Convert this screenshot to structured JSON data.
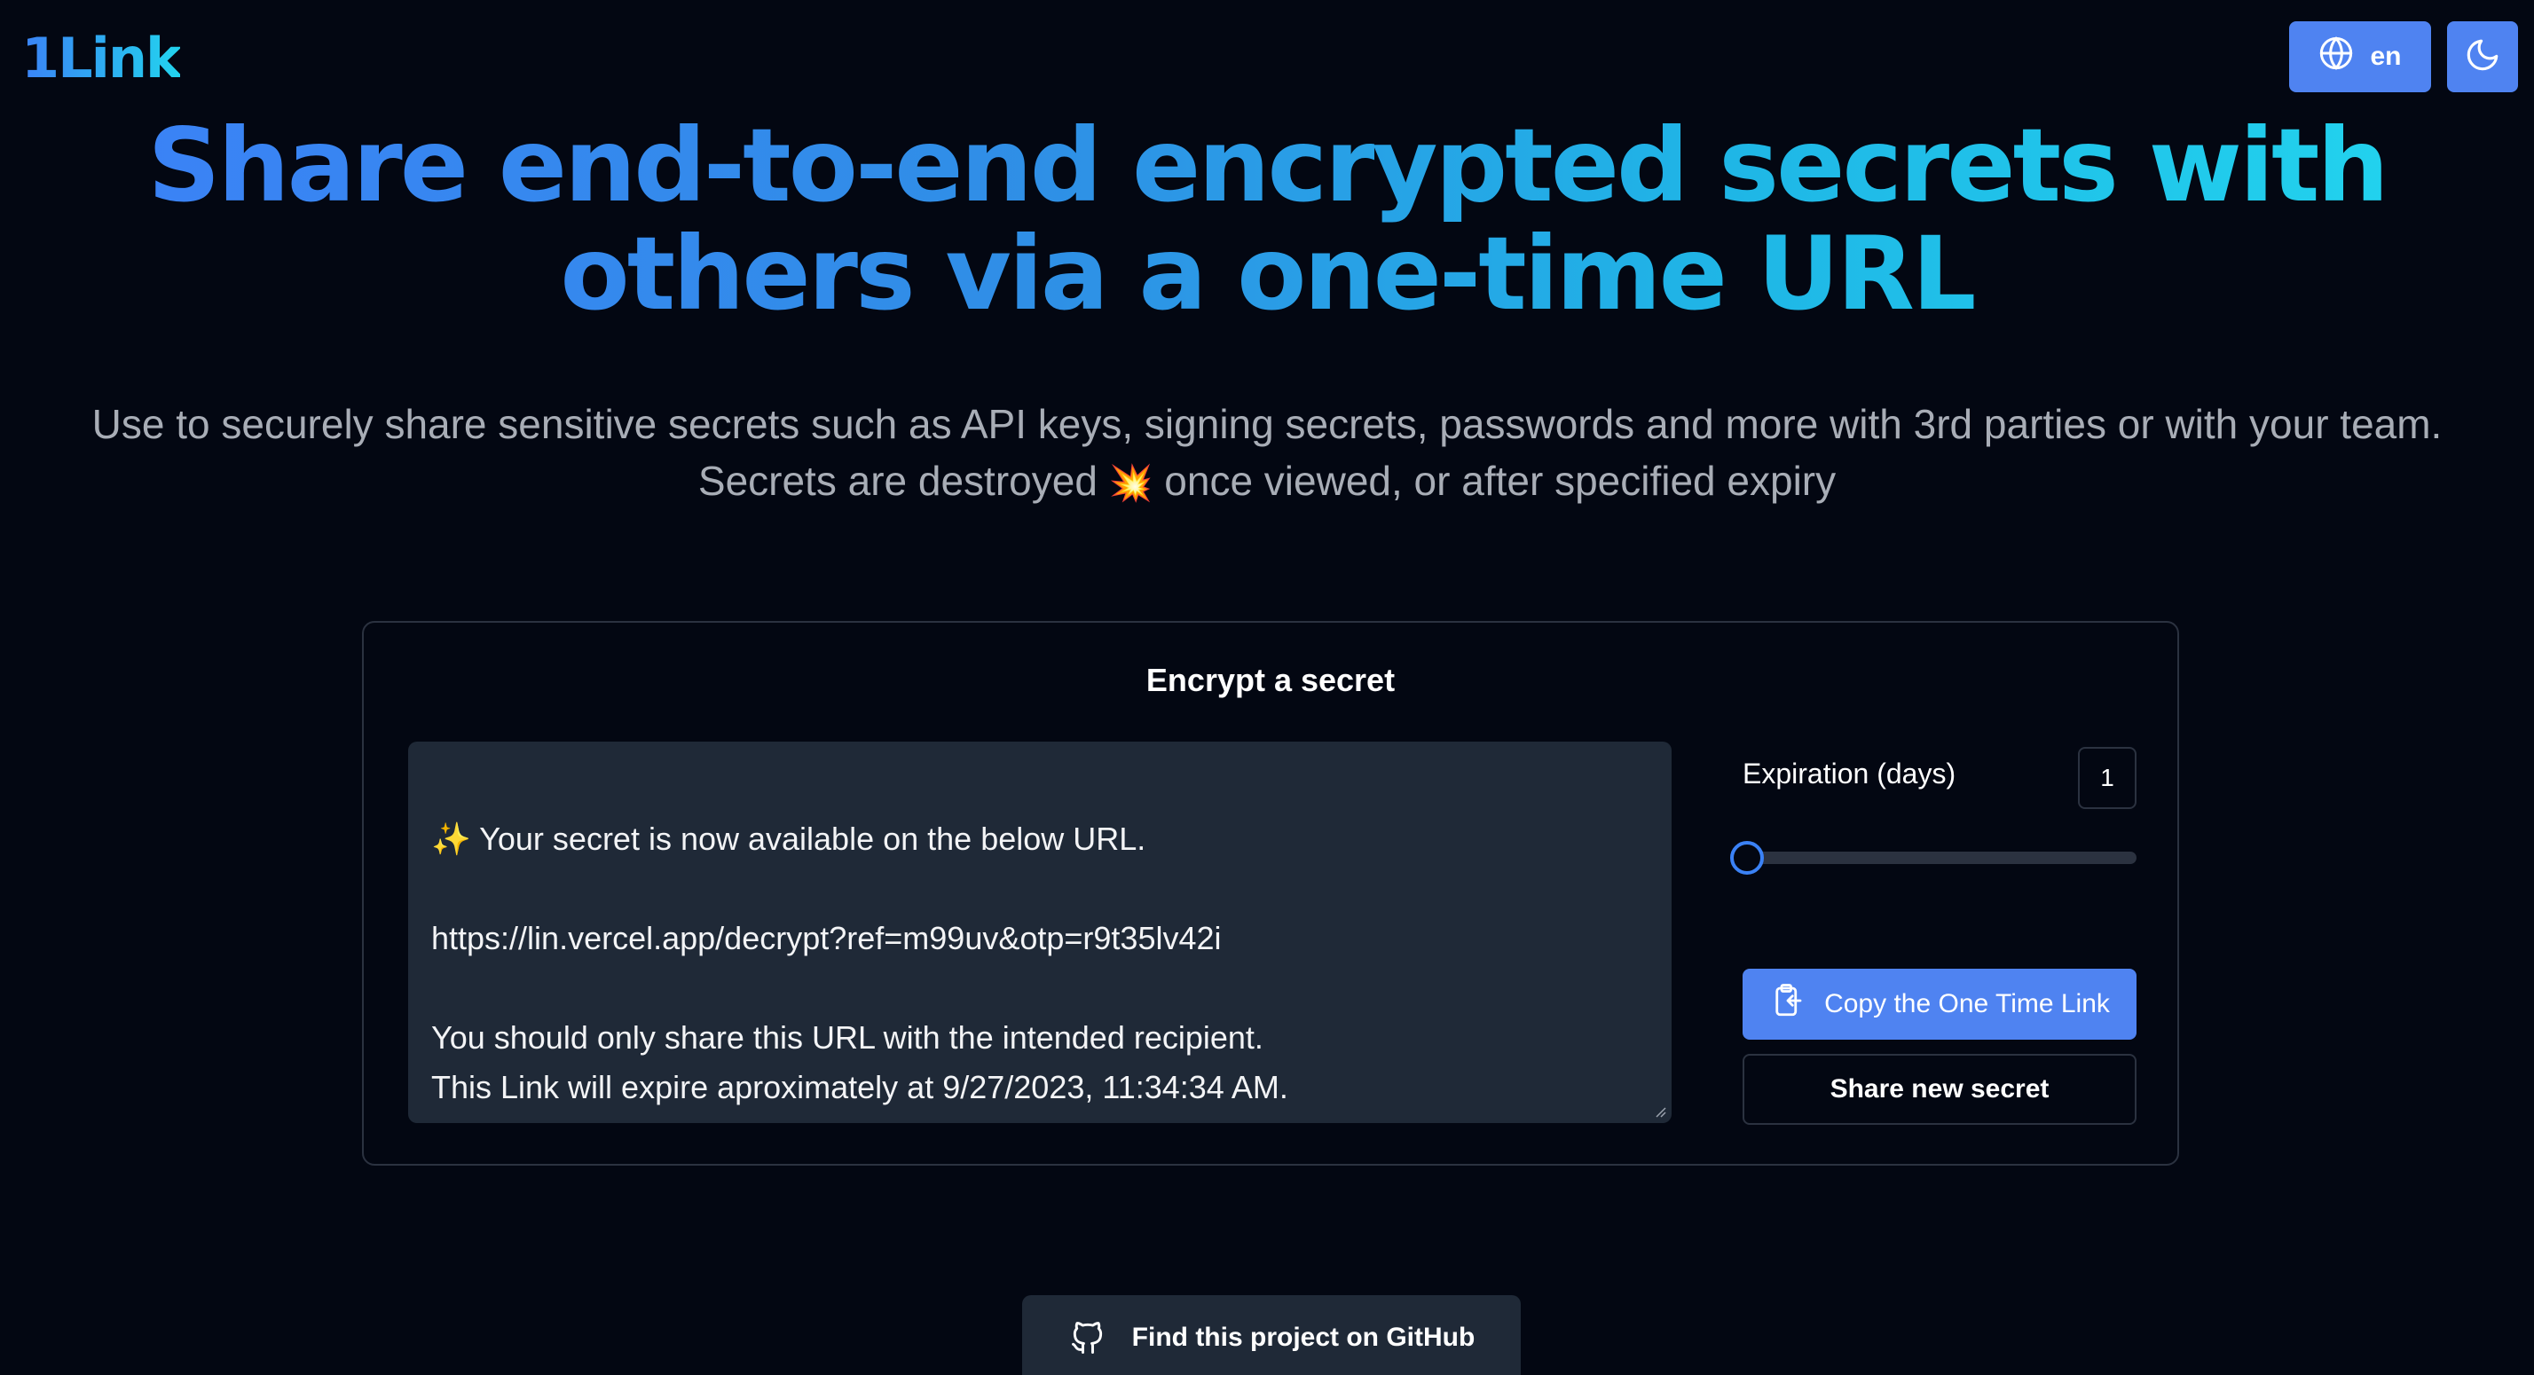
{
  "header": {
    "logo": "1Link",
    "language": "en",
    "language_icon": "globe-icon",
    "theme_icon": "moon-icon"
  },
  "hero": {
    "title": "Share end-to-end encrypted secrets with others via a one-time URL",
    "subtitle_line1": "Use to securely share sensitive secrets such as API keys, signing secrets, passwords and more with 3rd parties or with your team.",
    "subtitle_line2_a": "Secrets are destroyed",
    "subtitle_emoji": "💥",
    "subtitle_line2_b": "once viewed, or after specified expiry"
  },
  "card": {
    "title": "Encrypt a secret",
    "secret_text": "✨ Your secret is now available on the below URL.\n\nhttps://lin.vercel.app/decrypt?ref=m99uv&otp=r9t35lv42i\n\nYou should only share this URL with the intended recipient.\nThis Link will expire aproximately at 9/27/2023, 11:34:34 AM.",
    "expiration_label": "Expiration (days)",
    "expiration_value": "1",
    "slider_fraction": 0.0,
    "copy_button": "Copy the One Time Link",
    "copy_icon": "clipboard-icon",
    "new_button": "Share new secret"
  },
  "footer": {
    "github_label": "Find this project on GitHub",
    "github_icon": "github-icon"
  },
  "colors": {
    "background": "#030712",
    "accent": "#4f83f1",
    "gradient_start": "#3b82f6",
    "gradient_end": "#22d3ee",
    "surface": "#1f2937",
    "border": "#2b3240"
  }
}
